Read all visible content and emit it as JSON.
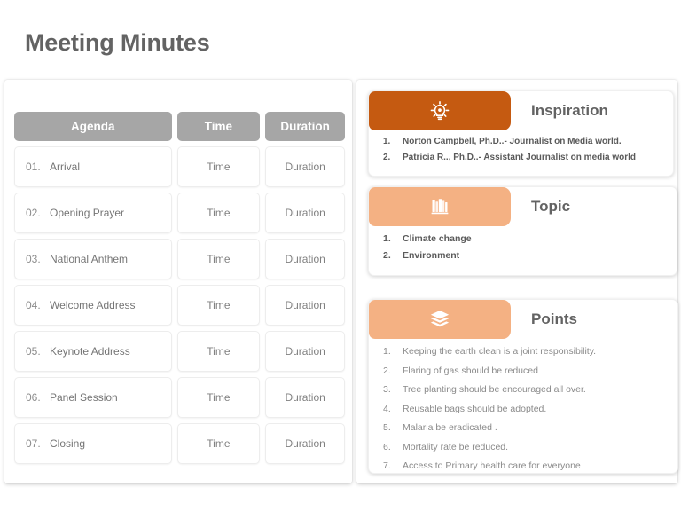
{
  "slide": {
    "title": "Meeting Minutes",
    "colors": {
      "title_text": "#636363",
      "header_grey": "#a6a6a6",
      "accent_dark_orange": "#c55a11",
      "accent_light_orange": "#f4b183",
      "body_text": "#808080",
      "background": "#ffffff"
    }
  },
  "agenda_table": {
    "columns": [
      "Agenda",
      "Time",
      "Duration"
    ],
    "rows": [
      {
        "num": "01.",
        "agenda": "Arrival",
        "time": "Time",
        "duration": "Duration"
      },
      {
        "num": "02.",
        "agenda": "Opening Prayer",
        "time": "Time",
        "duration": "Duration"
      },
      {
        "num": "03.",
        "agenda": "National Anthem",
        "time": "Time",
        "duration": "Duration"
      },
      {
        "num": "04.",
        "agenda": "Welcome Address",
        "time": "Time",
        "duration": "Duration"
      },
      {
        "num": "05.",
        "agenda": "Keynote Address",
        "time": "Time",
        "duration": "Duration"
      },
      {
        "num": "06.",
        "agenda": "Panel Session",
        "time": "Time",
        "duration": "Duration"
      },
      {
        "num": "07.",
        "agenda": "Closing",
        "time": "Time",
        "duration": "Duration"
      }
    ]
  },
  "cards": {
    "inspiration": {
      "title": "Inspiration",
      "icon": "lightbulb-icon",
      "items": [
        {
          "idx": "1.",
          "text": "Norton Campbell, Ph.D..- Journalist on Media world."
        },
        {
          "idx": "2.",
          "text": "Patricia R.., Ph.D..- Assistant Journalist on media world"
        }
      ]
    },
    "topic": {
      "title": "Topic",
      "icon": "books-shelf-icon",
      "items": [
        {
          "idx": "1.",
          "text": "Climate change"
        },
        {
          "idx": "2.",
          "text": "Environment"
        }
      ]
    },
    "points": {
      "title": "Points",
      "icon": "stacked-books-icon",
      "items": [
        {
          "idx": "1.",
          "text": "Keeping the earth clean is a joint responsibility."
        },
        {
          "idx": "2.",
          "text": "Flaring of gas should be reduced"
        },
        {
          "idx": "3.",
          "text": "Tree planting should be encouraged all over."
        },
        {
          "idx": "4.",
          "text": "Reusable bags should be adopted."
        },
        {
          "idx": "5.",
          "text": "Malaria be eradicated ."
        },
        {
          "idx": "6.",
          "text": "Mortality rate be reduced."
        },
        {
          "idx": "7.",
          "text": "Access to Primary health care for everyone"
        }
      ]
    }
  }
}
